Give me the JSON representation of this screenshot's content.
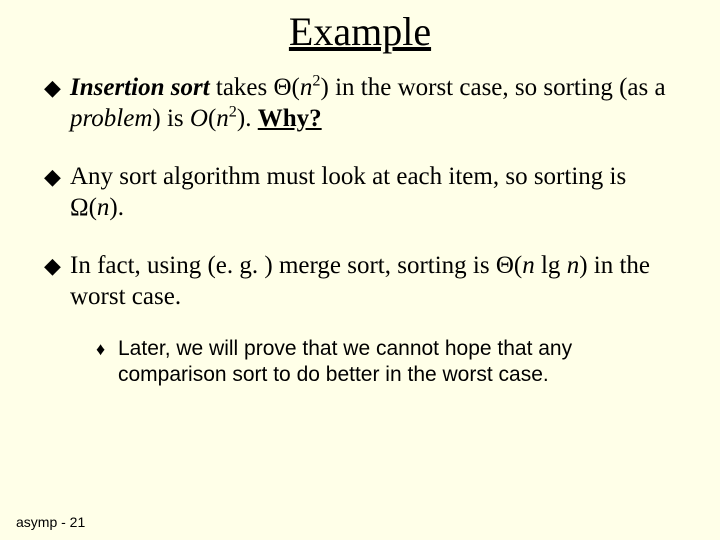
{
  "title": "Example",
  "bullets": {
    "b1": {
      "a": "Insertion sort",
      "b": " takes Θ(",
      "c": "n",
      "d": ") in the worst case, so sorting (as a ",
      "e": "problem",
      "f": ") is ",
      "g": "O",
      "h": "(",
      "i": "n",
      "j": ").  ",
      "k": "Why?"
    },
    "b2": {
      "a": "Any sort algorithm must look at each item, so sorting is Ω(",
      "b": "n",
      "c": ")."
    },
    "b3": {
      "a": "In fact, using (e. g. ) merge sort, sorting is Θ(",
      "b": "n",
      "c": " lg ",
      "d": "n",
      "e": ") in the worst case."
    },
    "sub1": "Later, we will prove that we cannot hope that any comparison sort to do better in the worst case."
  },
  "footer": "asymp - 21",
  "sup2": "2"
}
